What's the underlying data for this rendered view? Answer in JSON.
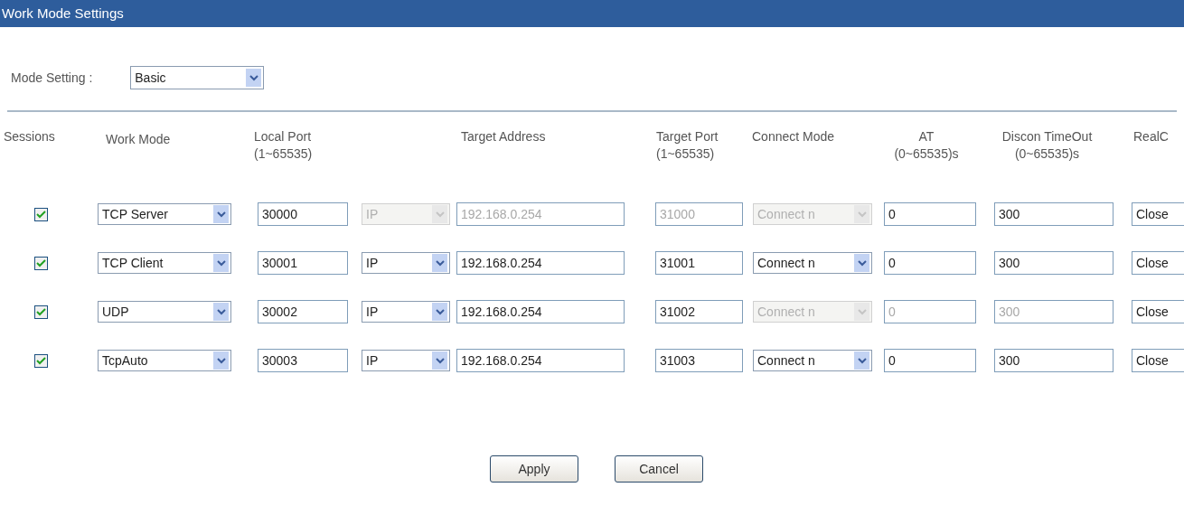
{
  "title": "Work Mode Settings",
  "mode_setting": {
    "label": "Mode Setting :",
    "value": "Basic"
  },
  "columns": [
    {
      "label": "Sessions"
    },
    {
      "label": "Work Mode"
    },
    {
      "label": "Local Port",
      "range": "(1~65535)"
    },
    {
      "label": "Target Address"
    },
    {
      "label": "Target Port",
      "range": "(1~65535)"
    },
    {
      "label": "Connect Mode"
    },
    {
      "label": "AT",
      "range": "(0~65535)s"
    },
    {
      "label": "Discon TimeOut",
      "range": "(0~65535)s"
    },
    {
      "label": "RealC"
    }
  ],
  "sessions": [
    {
      "checked": true,
      "work_mode": "TCP Server",
      "local_port": "30000",
      "address_type": {
        "value": "IP",
        "disabled": true
      },
      "target_address": {
        "value": "192.168.0.254",
        "disabled": true
      },
      "target_port": {
        "value": "31000",
        "disabled": true
      },
      "connect_mode": {
        "value": "Connect n",
        "disabled": true
      },
      "at": {
        "value": "0",
        "disabled": false
      },
      "discon_timeout": {
        "value": "300",
        "disabled": false
      },
      "realc": "Close"
    },
    {
      "checked": true,
      "work_mode": "TCP Client",
      "local_port": "30001",
      "address_type": {
        "value": "IP",
        "disabled": false
      },
      "target_address": {
        "value": "192.168.0.254",
        "disabled": false
      },
      "target_port": {
        "value": "31001",
        "disabled": false
      },
      "connect_mode": {
        "value": "Connect n",
        "disabled": false
      },
      "at": {
        "value": "0",
        "disabled": false
      },
      "discon_timeout": {
        "value": "300",
        "disabled": false
      },
      "realc": "Close"
    },
    {
      "checked": true,
      "work_mode": "UDP",
      "local_port": "30002",
      "address_type": {
        "value": "IP",
        "disabled": false
      },
      "target_address": {
        "value": "192.168.0.254",
        "disabled": false
      },
      "target_port": {
        "value": "31002",
        "disabled": false
      },
      "connect_mode": {
        "value": "Connect n",
        "disabled": true
      },
      "at": {
        "value": "0",
        "disabled": true
      },
      "discon_timeout": {
        "value": "300",
        "disabled": true
      },
      "realc": "Close"
    },
    {
      "checked": true,
      "work_mode": "TcpAuto",
      "local_port": "30003",
      "address_type": {
        "value": "IP",
        "disabled": false
      },
      "target_address": {
        "value": "192.168.0.254",
        "disabled": false
      },
      "target_port": {
        "value": "31003",
        "disabled": false
      },
      "connect_mode": {
        "value": "Connect n",
        "disabled": false
      },
      "at": {
        "value": "0",
        "disabled": false
      },
      "discon_timeout": {
        "value": "300",
        "disabled": false
      },
      "realc": "Close"
    }
  ],
  "buttons": [
    {
      "label": "Apply"
    },
    {
      "label": "Cancel"
    }
  ]
}
